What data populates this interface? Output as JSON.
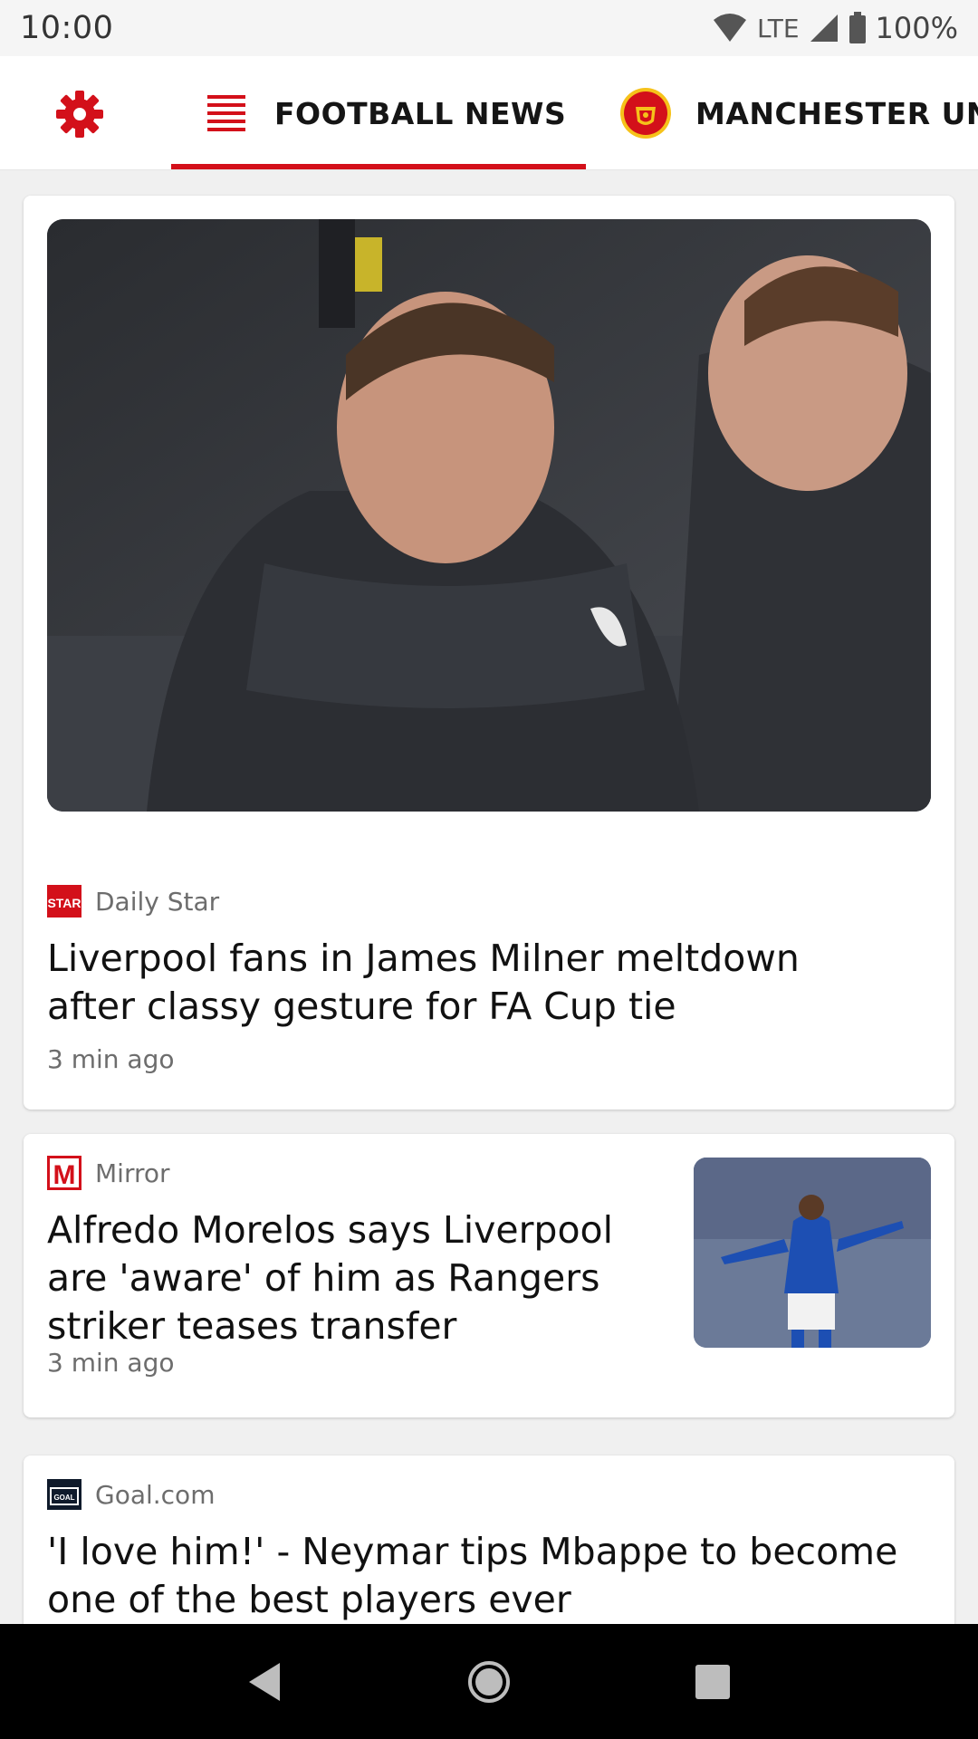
{
  "status_bar": {
    "time": "10:00",
    "network": "LTE",
    "battery": "100%"
  },
  "tabs": {
    "settings_icon": "gear-icon",
    "news_label": "FOOTBALL NEWS",
    "news_icon": "list-icon",
    "club_label": "MANCHESTER UN",
    "club_icon": "manchester-united-crest-icon"
  },
  "colors": {
    "accent": "#d3101a",
    "background": "#f0f0f0",
    "text": "#111111",
    "muted": "#6d6d6d"
  },
  "articles": [
    {
      "source": "Daily Star",
      "source_icon": "daily-star-logo-icon",
      "headline_line1": "Liverpool fans in James Milner meltdown",
      "headline_line2": "after classy gesture for FA Cup tie",
      "time": "3 min ago",
      "image": "hero-photo"
    },
    {
      "source": "Mirror",
      "source_icon": "mirror-logo-icon",
      "headline_line1": "Alfredo Morelos says Liverpool",
      "headline_line2": "are 'aware' of him as Rangers",
      "headline_line3": "striker teases transfer",
      "time": "3 min ago",
      "image": "thumbnail-photo"
    },
    {
      "source": "Goal.com",
      "source_icon": "goal-logo-icon",
      "headline_line1": "'I love him!' - Neymar tips Mbappe to become",
      "headline_line2": "one of the best players ever"
    }
  ],
  "nav": {
    "back": "back-icon",
    "home": "home-icon",
    "recents": "recents-icon"
  }
}
